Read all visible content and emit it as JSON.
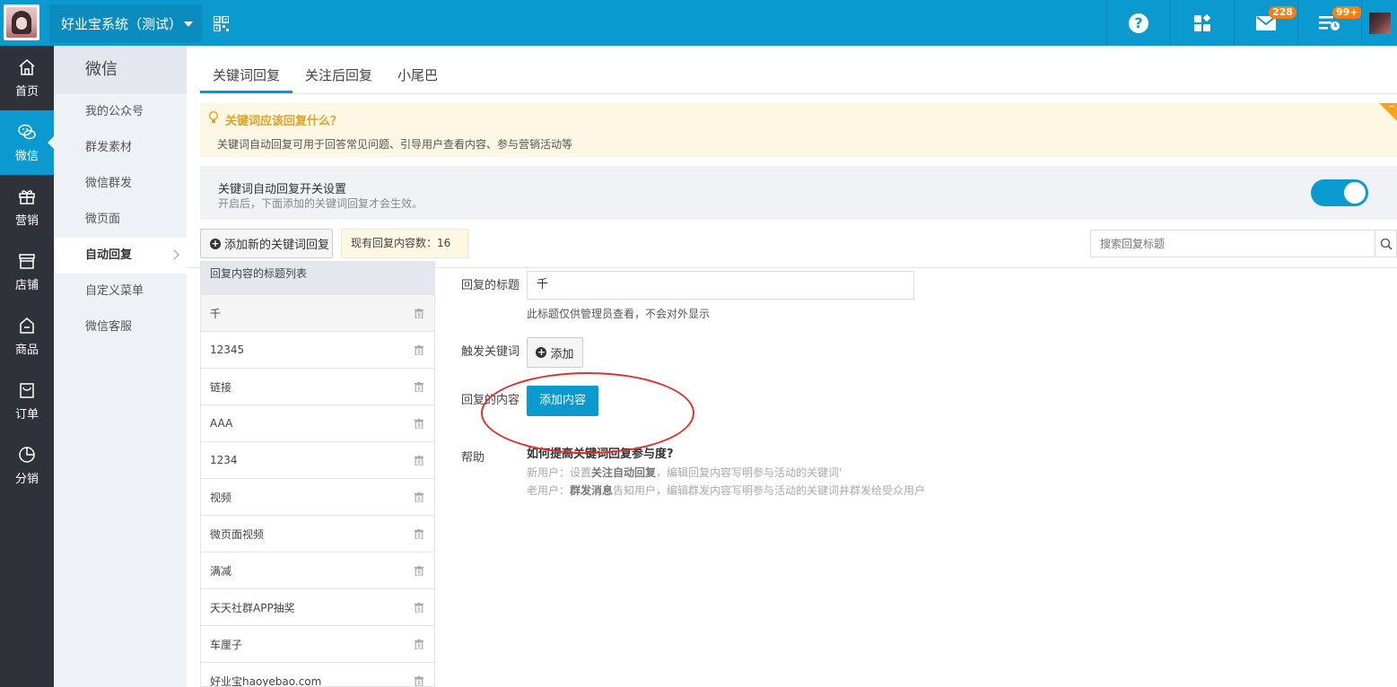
{
  "topbar": {
    "system_name": "好业宝系统（测试）",
    "icons": {
      "qr": "qrcode-icon",
      "help": "help-icon",
      "apps": "apps-icon",
      "mail": "mail-icon",
      "tasks": "tasks-icon"
    },
    "mail_badge": "228",
    "tasks_badge": "99+",
    "brand_color": "#0a9ad0"
  },
  "leftnav": {
    "items": [
      {
        "label": "首页",
        "icon": "home-icon"
      },
      {
        "label": "微信",
        "icon": "wechat-icon",
        "active": true
      },
      {
        "label": "营销",
        "icon": "gift-icon"
      },
      {
        "label": "店铺",
        "icon": "store-icon"
      },
      {
        "label": "商品",
        "icon": "product-icon"
      },
      {
        "label": "订单",
        "icon": "order-icon"
      },
      {
        "label": "分销",
        "icon": "pie-icon"
      }
    ]
  },
  "subnav": {
    "title": "微信",
    "items": [
      {
        "label": "我的公众号"
      },
      {
        "label": "群发素材"
      },
      {
        "label": "微信群发"
      },
      {
        "label": "微页面"
      },
      {
        "label": "自动回复",
        "active": true
      },
      {
        "label": "自定义菜单"
      },
      {
        "label": "微信客服"
      }
    ]
  },
  "tabs": [
    {
      "label": "关键词回复",
      "active": true
    },
    {
      "label": "关注后回复"
    },
    {
      "label": "小尾巴"
    }
  ],
  "tip": {
    "title": "关键词应该回复什么？",
    "desc": "关键词自动回复可用于回答常见问题、引导用户查看内容、参与营销活动等"
  },
  "switch_box": {
    "title": "关键词自动回复开关设置",
    "desc": "开启后，下面添加的关键词回复才会生效。",
    "enabled": true
  },
  "toolbar": {
    "add_label": "添加新的关键词回复",
    "count_text": "现有回复内容数：16",
    "search_placeholder": "搜索回复标题"
  },
  "list": {
    "header": "回复内容的标题列表",
    "rows": [
      "千",
      "12345",
      "链接",
      "AAA",
      "1234",
      "视频",
      "微页面视频",
      "满减",
      "天天社群APP抽奖",
      "车厘子",
      "好业宝haoyebao.com"
    ]
  },
  "form": {
    "title_label": "回复的标题",
    "title_value": "千",
    "title_hint": "此标题仅供管理员查看，不会对外显示",
    "keyword_label": "触发关键词",
    "keyword_add": "添加",
    "content_label": "回复的内容",
    "content_add": "添加内容",
    "help_label": "帮助",
    "help_title": "如何提高关键词回复参与度?",
    "help_new_prefix": "新用户：设置",
    "help_new_bold": "关注自动回复",
    "help_new_suffix": "，编辑回复内容写明参与活动的关键词'",
    "help_old_prefix": "老用户：",
    "help_old_bold": "群发消息",
    "help_old_suffix": "告知用户，编辑群发内容写明参与活动的关键词并群发给受众用户"
  }
}
